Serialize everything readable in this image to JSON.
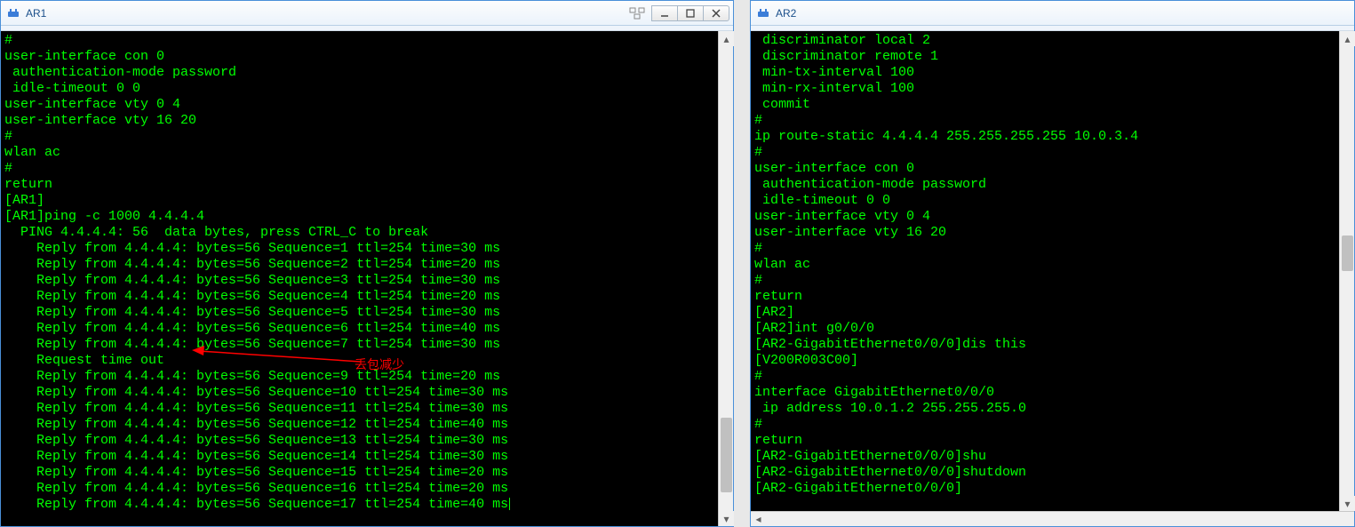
{
  "windows": {
    "left": {
      "title": "AR1",
      "terminal_lines": [
        "#",
        "user-interface con 0",
        " authentication-mode password",
        " idle-timeout 0 0",
        "user-interface vty 0 4",
        "user-interface vty 16 20",
        "#",
        "wlan ac",
        "#",
        "return",
        "[AR1]",
        "[AR1]ping -c 1000 4.4.4.4",
        "  PING 4.4.4.4: 56  data bytes, press CTRL_C to break",
        "    Reply from 4.4.4.4: bytes=56 Sequence=1 ttl=254 time=30 ms",
        "    Reply from 4.4.4.4: bytes=56 Sequence=2 ttl=254 time=20 ms",
        "    Reply from 4.4.4.4: bytes=56 Sequence=3 ttl=254 time=30 ms",
        "    Reply from 4.4.4.4: bytes=56 Sequence=4 ttl=254 time=20 ms",
        "    Reply from 4.4.4.4: bytes=56 Sequence=5 ttl=254 time=30 ms",
        "    Reply from 4.4.4.4: bytes=56 Sequence=6 ttl=254 time=40 ms",
        "    Reply from 4.4.4.4: bytes=56 Sequence=7 ttl=254 time=30 ms",
        "    Request time out",
        "    Reply from 4.4.4.4: bytes=56 Sequence=9 ttl=254 time=20 ms",
        "    Reply from 4.4.4.4: bytes=56 Sequence=10 ttl=254 time=30 ms",
        "    Reply from 4.4.4.4: bytes=56 Sequence=11 ttl=254 time=30 ms",
        "    Reply from 4.4.4.4: bytes=56 Sequence=12 ttl=254 time=40 ms",
        "    Reply from 4.4.4.4: bytes=56 Sequence=13 ttl=254 time=30 ms",
        "    Reply from 4.4.4.4: bytes=56 Sequence=14 ttl=254 time=30 ms",
        "    Reply from 4.4.4.4: bytes=56 Sequence=15 ttl=254 time=20 ms",
        "    Reply from 4.4.4.4: bytes=56 Sequence=16 ttl=254 time=20 ms",
        "    Reply from 4.4.4.4: bytes=56 Sequence=17 ttl=254 time=40 ms"
      ],
      "annotation": "丢包减少",
      "scrollbar": {
        "thumb_top_pct": 80,
        "thumb_height_pct": 16
      }
    },
    "right": {
      "title": "AR2",
      "terminal_lines": [
        " discriminator local 2",
        " discriminator remote 1",
        " min-tx-interval 100",
        " min-rx-interval 100",
        " commit",
        "#",
        "ip route-static 4.4.4.4 255.255.255.255 10.0.3.4",
        "#",
        "user-interface con 0",
        " authentication-mode password",
        " idle-timeout 0 0",
        "user-interface vty 0 4",
        "user-interface vty 16 20",
        "#",
        "wlan ac",
        "#",
        "return",
        "[AR2]",
        "[AR2]int g0/0/0",
        "[AR2-GigabitEthernet0/0/0]dis this",
        "[V200R003C00]",
        "#",
        "interface GigabitEthernet0/0/0",
        " ip address 10.0.1.2 255.255.255.0",
        "#",
        "return",
        "[AR2-GigabitEthernet0/0/0]shu",
        "[AR2-GigabitEthernet0/0/0]shutdown",
        "[AR2-GigabitEthernet0/0/0]"
      ],
      "scrollbar": {
        "thumb_top_pct": 42,
        "thumb_height_pct": 8
      }
    }
  },
  "colors": {
    "term_fg": "#00ff00",
    "term_bg": "#000000",
    "annotation": "#ff0000",
    "title_accent": "#1a4f8b"
  }
}
